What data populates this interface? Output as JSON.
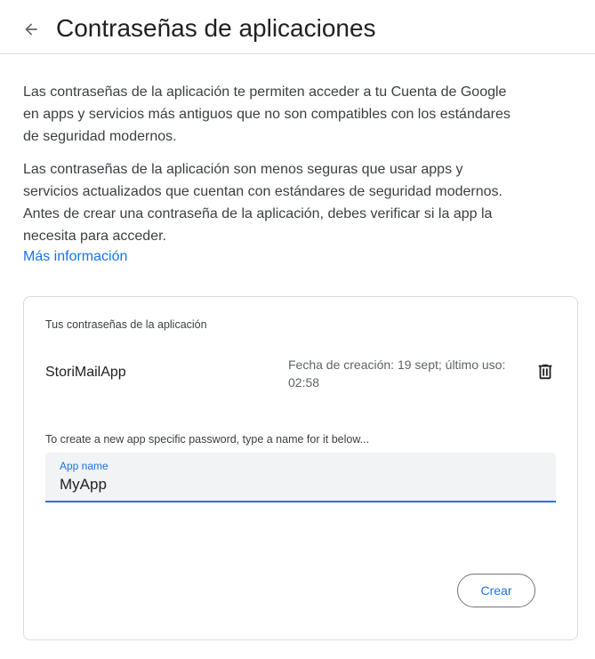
{
  "header": {
    "title": "Contraseñas de aplicaciones",
    "back_icon": "arrow-back-icon"
  },
  "intro": {
    "paragraph_1": "Las contraseñas de la aplicación te permiten acceder a tu Cuenta de Google en apps y servicios más antiguos que no son compatibles con los estándares de seguridad modernos.",
    "paragraph_2": "Las contraseñas de la aplicación son menos seguras que usar apps y servicios actualizados que cuentan con estándares de seguridad modernos. Antes de crear una contraseña de la aplicación, debes verificar si la app la necesita para acceder.",
    "more_link": "Más información"
  },
  "card": {
    "heading": "Tus contraseñas de la aplicación",
    "apps": [
      {
        "name": "StoriMailApp",
        "meta": "Fecha de creación: 19 sept; último uso: 02:58",
        "delete_icon": "trash-icon"
      }
    ],
    "hint": "To create a new app specific password, type a name for it below...",
    "field": {
      "label": "App name",
      "value": "MyApp"
    },
    "create_label": "Crear"
  },
  "colors": {
    "accent": "#1a73e8",
    "text": "#202124",
    "secondary_text": "#5f6368",
    "border": "#dadce0",
    "field_bg": "#f1f3f4"
  }
}
